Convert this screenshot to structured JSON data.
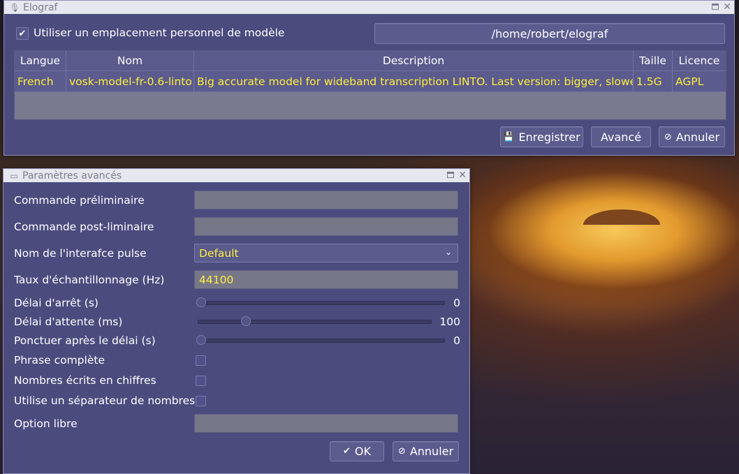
{
  "main_window": {
    "title": "Elograf",
    "use_custom_location_label": "Utiliser un emplacement personnel de modèle",
    "use_custom_location_checked": true,
    "path_button_label": "/home/robert/elograf",
    "table": {
      "headers": [
        "Langue",
        "Nom",
        "Description",
        "Taille",
        "Licence"
      ],
      "rows": [
        {
          "language": "French",
          "name": "vosk-model-fr-0.6-linto",
          "description": "Big accurate model for wideband transcription LINTO. Last version: bigger, slower",
          "size": "1.5G",
          "license": "AGPL"
        }
      ]
    },
    "buttons": {
      "save": "Enregistrer",
      "advanced": "Avancé",
      "cancel": "Annuler"
    }
  },
  "advanced_window": {
    "title": "Paramètres avancés",
    "pre_command_label": "Commande préliminaire",
    "pre_command_value": "",
    "post_command_label": "Commande post-liminaire",
    "post_command_value": "",
    "pulse_interface_label": "Nom de l'interafce pulse",
    "pulse_interface_value": "Default",
    "sample_rate_label": "Taux d'échantillonnage (Hz)",
    "sample_rate_value": "44100",
    "stop_delay_label": "Délai d'arrêt (s)",
    "stop_delay_value": "0",
    "wait_delay_label": "Délai d'attente (ms)",
    "wait_delay_value": "100",
    "punctuate_delay_label": "Ponctuer après le délai (s)",
    "punctuate_delay_value": "0",
    "full_sentence_label": "Phrase complète",
    "digits_label": "Nombres écrits en chiffres",
    "separator_label": "Utilise un séparateur de nombres",
    "free_option_label": "Option libre",
    "free_option_value": "",
    "ok_label": "OK",
    "cancel_label": "Annuler"
  },
  "icons": {
    "app": "microphone-icon",
    "maximize": "maximize-icon",
    "close": "close-icon",
    "save": "floppy-icon",
    "cancel": "cancel-icon",
    "ok": "check-icon"
  }
}
